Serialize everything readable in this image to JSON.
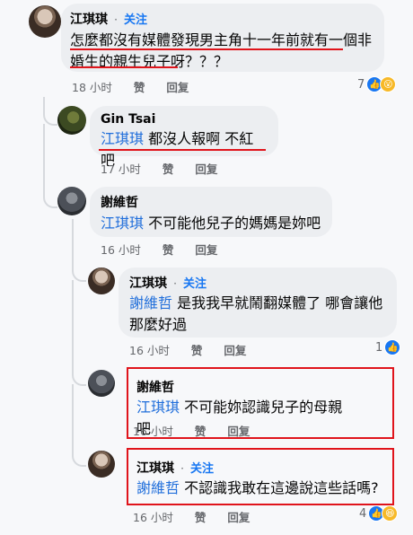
{
  "comments": [
    {
      "author": "江琪琪",
      "follow": "关注",
      "text_line1": "怎麼都沒有媒體發現男主角十一年前就有一個非",
      "text_line2": "婚生的親生兒子呀？？？",
      "time": "18 小时",
      "like": "赞",
      "reply": "回复",
      "reaction_count": "7"
    },
    {
      "author": "Gin Tsai",
      "mention": "江琪琪",
      "text": "都沒人報啊 不紅吧",
      "time": "17 小时",
      "like": "赞",
      "reply": "回复"
    },
    {
      "author": "謝維哲",
      "mention": "江琪琪",
      "text": "不可能他兒子的媽媽是妳吧",
      "time": "16 小时",
      "like": "赞",
      "reply": "回复"
    },
    {
      "author": "江琪琪",
      "follow": "关注",
      "mention": "謝維哲",
      "text_line1": "是我我早就鬧翻媒體了 哪會讓他",
      "text_line2": "那麼好過",
      "time": "16 小时",
      "like": "赞",
      "reply": "回复",
      "reaction_count": "1"
    },
    {
      "author": "謝維哲",
      "mention": "江琪琪",
      "text": "不可能妳認識兒子的母親吧",
      "time": "16 小时",
      "like": "赞",
      "reply": "回复"
    },
    {
      "author": "江琪琪",
      "follow": "关注",
      "mention": "謝維哲",
      "text": "不認識我敢在這邊說這些話嗎?",
      "time": "16 小时",
      "like": "赞",
      "reply": "回复",
      "reaction_count": "4"
    }
  ],
  "dot": "·",
  "icons": [
    "like-reaction-icon",
    "wow-reaction-icon",
    "haha-reaction-icon"
  ],
  "colors": {
    "highlight": "#e0141b",
    "mention": "#216fdb",
    "bubble": "#eceef1"
  }
}
